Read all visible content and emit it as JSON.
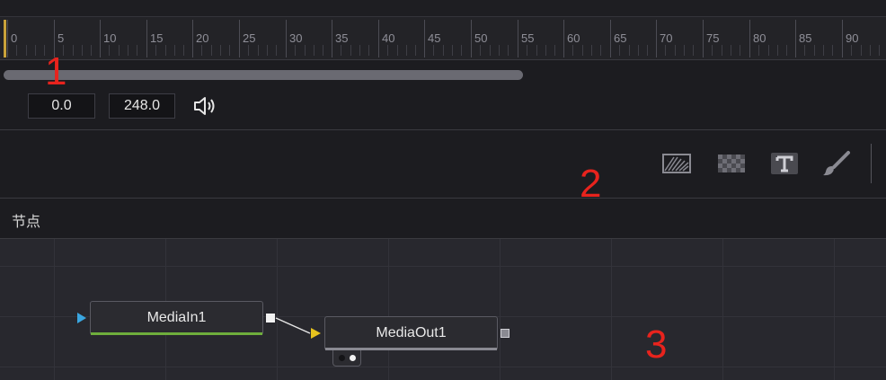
{
  "timeline": {
    "ruler_labels": [
      "0",
      "5",
      "10",
      "15",
      "20",
      "25",
      "30",
      "35",
      "40",
      "45",
      "50",
      "55",
      "60",
      "65",
      "70",
      "75",
      "80",
      "85",
      "90"
    ],
    "start_value": "0.0",
    "end_value": "248.0"
  },
  "toolbar": {
    "tools": [
      "background-tool-icon",
      "fastnoise-tool-icon",
      "text-tool-icon",
      "paint-tool-icon"
    ]
  },
  "panel": {
    "title": "节点"
  },
  "nodes": {
    "media_in": "MediaIn1",
    "media_out": "MediaOut1"
  },
  "annotations": {
    "one": "1",
    "two": "2",
    "three": "3"
  },
  "colors": {
    "playhead": "#c9a23a",
    "annotation": "#e8231d",
    "media_in_bar": "#6fae3c",
    "input_triangle_blue": "#3aa6e0",
    "input_triangle_yellow": "#e6c21e"
  }
}
